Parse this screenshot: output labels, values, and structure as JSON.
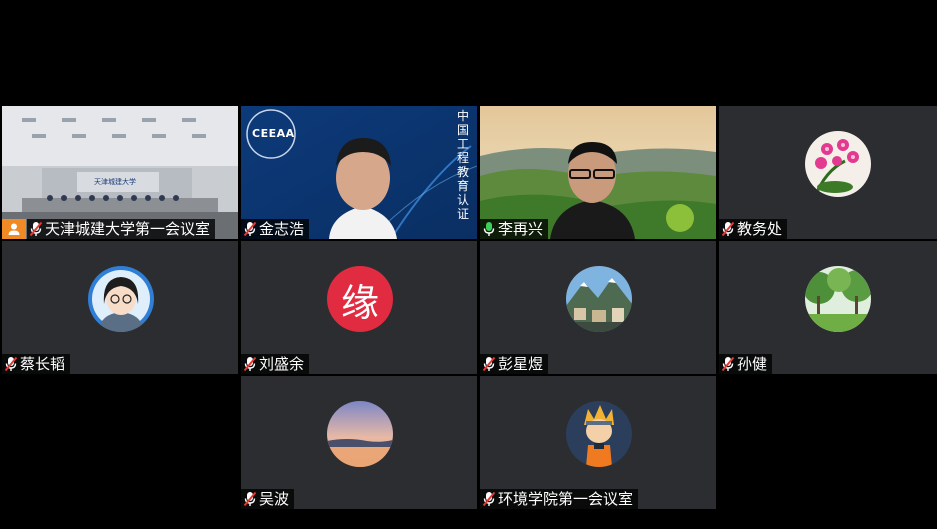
{
  "participants": [
    {
      "name": "天津城建大学第一会议室",
      "mic": "muted",
      "host": true,
      "video": "meeting-room"
    },
    {
      "name": "金志浩",
      "mic": "muted",
      "video": "speaker-ceeaa"
    },
    {
      "name": "李再兴",
      "mic": "active",
      "video": "landscape"
    },
    {
      "name": "教务处",
      "mic": "muted",
      "avatar": "orchid-icon"
    },
    {
      "name": "蔡长韬",
      "mic": "muted",
      "avatar": "cartoon-woman-icon"
    },
    {
      "name": "刘盛余",
      "mic": "muted",
      "avatar": "yuan-character-icon"
    },
    {
      "name": "彭星煜",
      "mic": "muted",
      "avatar": "mountain-village-icon"
    },
    {
      "name": "孙健",
      "mic": "muted",
      "avatar": "park-trees-icon"
    },
    {
      "name": "吴波",
      "mic": "muted",
      "avatar": "sunset-lake-icon"
    },
    {
      "name": "环境学院第一会议室",
      "mic": "muted",
      "avatar": "cartoon-ninja-icon"
    }
  ],
  "overlays": {
    "room_banner": "天津城建大学",
    "ceeaa_logo": "CEEAA",
    "ceeaa_vertical": "中国工程教育认证",
    "avatar_char": "缘"
  },
  "colors": {
    "tile_bg": "#2b2d30",
    "active_border": "#2fbf6a",
    "muted_mic": "#e53935",
    "active_mic": "#3ccf5a",
    "host_badge": "#f08a24"
  }
}
